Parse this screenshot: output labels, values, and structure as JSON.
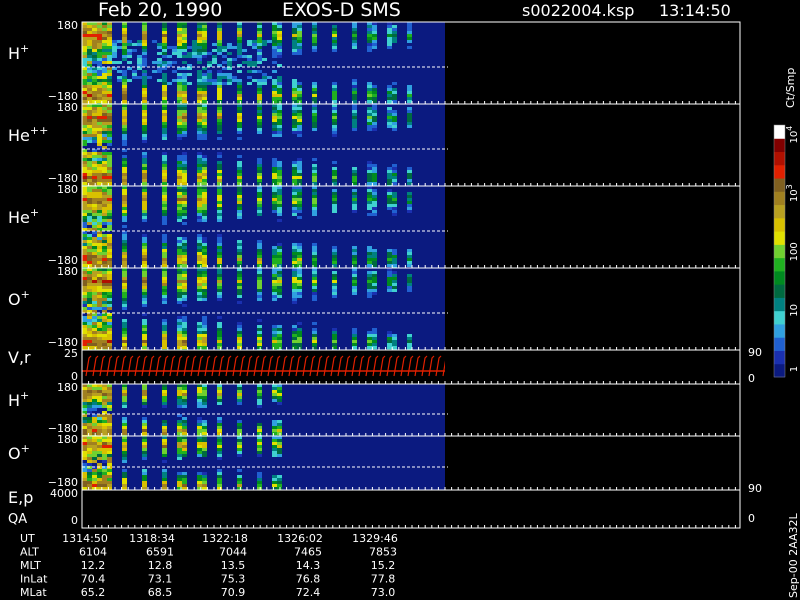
{
  "header": {
    "date": "Feb 20, 1990",
    "mission": "EXOS-D SMS",
    "file": "s0022004.ksp",
    "time": "13:14:50"
  },
  "colorbar": {
    "unit": "Ct/Smp",
    "ticks": [
      {
        "label": "1",
        "value": 1
      },
      {
        "label": "10",
        "value": 10
      },
      {
        "label": "100",
        "value": 100
      },
      {
        "label": "10",
        "exp": "3",
        "value": 1000
      },
      {
        "label": "10",
        "exp": "4",
        "value": 10000
      }
    ],
    "colors": [
      "#0b1a80",
      "#1a30b0",
      "#2060d0",
      "#30a0e0",
      "#40d0d0",
      "#008080",
      "#006a40",
      "#008a20",
      "#20b020",
      "#70d030",
      "#e0e000",
      "#d8c000",
      "#b8a020",
      "#a08020",
      "#806020",
      "#e02000",
      "#b01000",
      "#800000",
      "#ffffff"
    ]
  },
  "panels": [
    {
      "species": "H",
      "charge": "+",
      "ytop": "180",
      "ybot": "−180"
    },
    {
      "species": "He",
      "charge": "++",
      "ytop": "180",
      "ybot": "−180"
    },
    {
      "species": "He",
      "charge": "+",
      "ytop": "180",
      "ybot": "−180"
    },
    {
      "species": "O",
      "charge": "+",
      "ytop": "180",
      "ybot": "−180",
      "right": "90"
    },
    {
      "species": "V,r",
      "charge": "",
      "ytop": "25",
      "ybot": "0",
      "right": "0"
    },
    {
      "species": "H",
      "charge": "+",
      "ytop": "180",
      "ybot": "−180"
    },
    {
      "species": "O",
      "charge": "+",
      "ytop": "180",
      "ybot": "−180"
    },
    {
      "species": "E,p",
      "charge": "",
      "species2": "QA",
      "ytop": "4000",
      "ybot": "0",
      "right_top": "90",
      "right_bot": "0"
    }
  ],
  "ephemeris": {
    "rows": [
      {
        "label": "UT",
        "values": [
          "1314:50",
          "1318:34",
          "1322:18",
          "1326:02",
          "1329:46"
        ]
      },
      {
        "label": "ALT",
        "values": [
          "6104",
          "6591",
          "7044",
          "7465",
          "7853"
        ]
      },
      {
        "label": "MLT",
        "values": [
          "12.2",
          "12.8",
          "13.5",
          "14.3",
          "15.2"
        ]
      },
      {
        "label": "InLat",
        "values": [
          "70.4",
          "73.1",
          "75.3",
          "76.8",
          "77.8"
        ]
      },
      {
        "label": "MLat",
        "values": [
          "65.2",
          "68.5",
          "70.9",
          "72.4",
          "73.0"
        ]
      }
    ]
  },
  "footer_id": "Sep-00  2AA32L",
  "chart_data": {
    "type": "heatmap",
    "title": "Feb 20, 1990   EXOS-D SMS",
    "subtitle": "s0022004.ksp  13:14:50",
    "x_axis": "UT",
    "x_ticks": [
      "1314:50",
      "1318:34",
      "1322:18",
      "1326:02",
      "1329:46"
    ],
    "panels": [
      "H+",
      "He++",
      "He+",
      "O+",
      "V,r",
      "H+",
      "O+",
      "E,p / QA"
    ],
    "colorbar": {
      "label": "Ct/Smp",
      "scale": "log",
      "range": [
        1,
        10000
      ]
    }
  }
}
